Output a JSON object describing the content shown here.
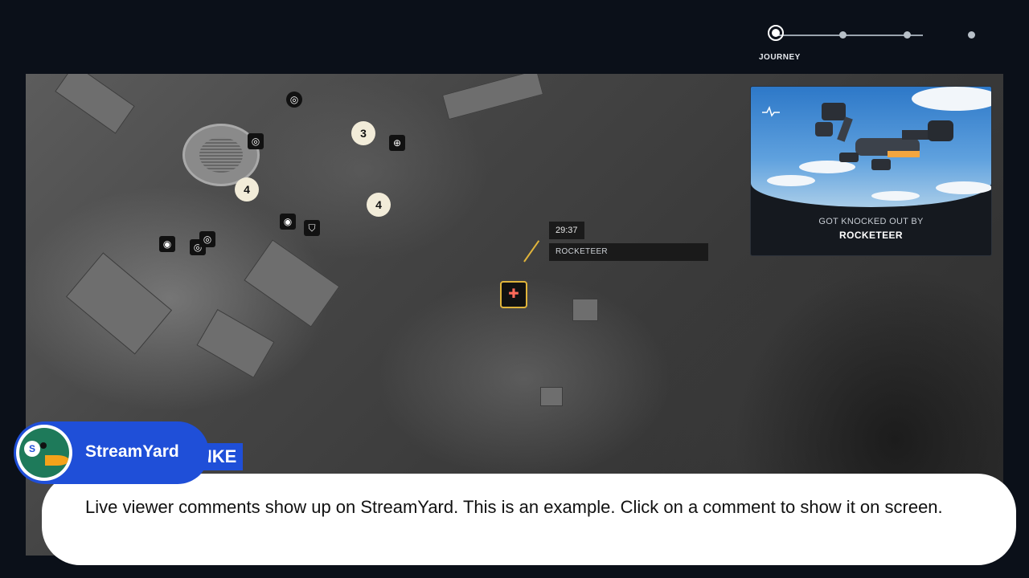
{
  "journey": {
    "label": "JOURNEY",
    "steps_total": 4,
    "current_step": 1
  },
  "map": {
    "markers": [
      {
        "label": "3"
      },
      {
        "label": "4"
      },
      {
        "label": "4"
      }
    ],
    "event": {
      "timer": "29:37",
      "name": "ROCKETEER"
    }
  },
  "knockout_card": {
    "caption": "GOT KNOCKED OUT BY",
    "enemy": "ROCKETEER"
  },
  "player_tag": {
    "visible_text": "IKE"
  },
  "streamyard": {
    "brand": "StreamYard",
    "comment": "Live viewer comments show up on StreamYard. This is an example. Click on a comment to show it on screen.",
    "colors": {
      "accent": "#1f4fd8",
      "bubble": "#ffffff"
    }
  }
}
